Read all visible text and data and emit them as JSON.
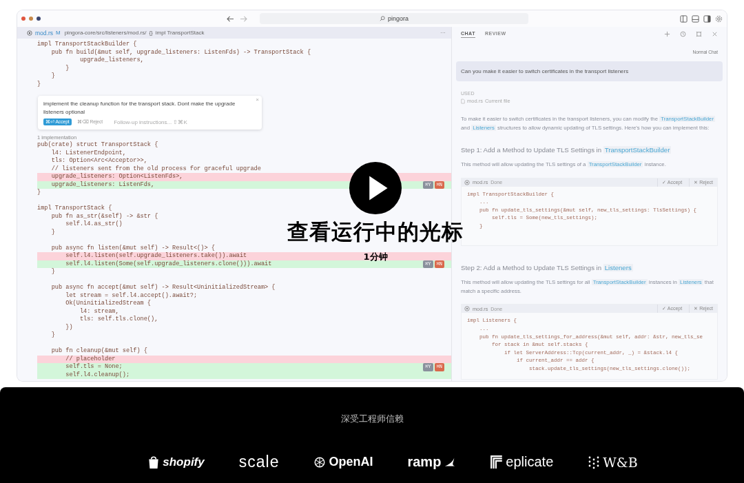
{
  "window": {
    "search": "pingora"
  },
  "editor_tab": {
    "file": "mod.rs",
    "status": "M",
    "path": "pingora-core/src/listeners/mod.rs/",
    "symbol_icon": "{}",
    "symbol": "impl TransportStack",
    "more": "···"
  },
  "editor": [
    {
      "kind": "code",
      "lines": [
        {
          "text": "impl TransportStackBuilder {",
          "added": false,
          "removed": false
        },
        {
          "text": "    pub fn build(&mut self, upgrade_listeners: ListenFds) -> TransportStack {",
          "added": false,
          "removed": false
        },
        {
          "text": "            upgrade_listeners,",
          "added": false,
          "removed": false
        },
        {
          "text": "        }",
          "added": false,
          "removed": false
        },
        {
          "text": "    }",
          "added": false,
          "removed": false
        },
        {
          "text": "}",
          "added": false,
          "removed": false
        }
      ]
    },
    {
      "kind": "prompt",
      "text": "implement the cleanup function for the transport stack. Dont make the upgrade listeners optional",
      "close": "×",
      "accept": "⌘⏎ Accept",
      "reject": "⌘⌫ Reject",
      "followup": "Follow-up instructions... ⇧⌘K"
    },
    {
      "kind": "lens",
      "text": "1 implementation"
    },
    {
      "kind": "code",
      "lines": [
        {
          "text": "pub(crate) struct TransportStack {",
          "added": false,
          "removed": false
        },
        {
          "text": "    l4: ListenerEndpoint,",
          "added": false,
          "removed": false
        },
        {
          "text": "    tls: Option<Arc<Acceptor>>,",
          "added": false,
          "removed": false
        },
        {
          "text": "    // listeners sent from the old process for graceful upgrade",
          "added": false,
          "removed": false
        },
        {
          "text": "    upgrade_listeners: Option<ListenFds>,",
          "added": false,
          "removed": true
        },
        {
          "text": "    upgrade_listeners: ListenFds,",
          "added": true,
          "removed": false,
          "actions": [
            "⌘Y",
            "⌘N"
          ]
        },
        {
          "text": "}",
          "added": false,
          "removed": false
        }
      ]
    },
    {
      "kind": "code",
      "lines": [
        {
          "text": "impl TransportStack {",
          "added": false,
          "removed": false
        },
        {
          "text": "    pub fn as_str(&self) -> &str {",
          "added": false,
          "removed": false
        },
        {
          "text": "        self.l4.as_str()",
          "added": false,
          "removed": false
        },
        {
          "text": "    }",
          "added": false,
          "removed": false
        }
      ]
    },
    {
      "kind": "code",
      "lines": [
        {
          "text": "    pub async fn listen(&mut self) -> Result<()> {",
          "added": false,
          "removed": false
        },
        {
          "text": "        self.l4.listen(self.upgrade_listeners.take()).await",
          "added": false,
          "removed": true
        },
        {
          "text": "        self.l4.listen(Some(self.upgrade_listeners.clone())).await",
          "added": true,
          "removed": false,
          "actions": [
            "⌘Y",
            "⌘N"
          ]
        },
        {
          "text": "    }",
          "added": false,
          "removed": false
        }
      ]
    },
    {
      "kind": "code",
      "lines": [
        {
          "text": "    pub async fn accept(&mut self) -> Result<UninitializedStream> {",
          "added": false,
          "removed": false
        },
        {
          "text": "        let stream = self.l4.accept().await?;",
          "added": false,
          "removed": false
        },
        {
          "text": "        Ok(UninitializedStream {",
          "added": false,
          "removed": false
        },
        {
          "text": "            l4: stream,",
          "added": false,
          "removed": false
        },
        {
          "text": "            tls: self.tls.clone(),",
          "added": false,
          "removed": false
        },
        {
          "text": "        })",
          "added": false,
          "removed": false
        },
        {
          "text": "    }",
          "added": false,
          "removed": false
        }
      ]
    },
    {
      "kind": "code",
      "lines": [
        {
          "text": "    pub fn cleanup(&mut self) {",
          "added": false,
          "removed": false
        },
        {
          "text": "        // placeholder",
          "added": false,
          "removed": true
        },
        {
          "text": "        self.tls = None;",
          "added": true,
          "removed": false,
          "actions": [
            "⌘Y",
            "⌘N"
          ]
        },
        {
          "text": "        self.l4.cleanup();",
          "added": true,
          "removed": false
        }
      ]
    }
  ],
  "chat": {
    "tabs": [
      {
        "label": "CHAT",
        "selected": true
      },
      {
        "label": "REVIEW",
        "selected": false
      }
    ],
    "mode": "Normal Chat",
    "user_message": "Can you make it easier to switch certificates in the transport listeners",
    "used": {
      "label": "USED",
      "file": "mod.rs",
      "note": "Current file"
    },
    "blocks": [
      {
        "kind": "paragraph",
        "parts": [
          {
            "text": "To make it easier to switch certificates in the transport listeners, you can modify the ",
            "code": false
          },
          {
            "text": "TransportStackBuilder",
            "code": true
          },
          {
            "text": " and ",
            "code": false
          },
          {
            "text": "Listeners",
            "code": true
          },
          {
            "text": " structures to allow dynamic updating of TLS settings. Here's how you can implement this:",
            "code": false
          }
        ]
      },
      {
        "kind": "heading",
        "parts": [
          {
            "text": "Step 1: Add a Method to Update TLS Settings in ",
            "code": false
          },
          {
            "text": "TransportStackBuilder",
            "code": true
          }
        ]
      },
      {
        "kind": "paragraph",
        "parts": [
          {
            "text": "This method will allow updating the TLS settings of a ",
            "code": false
          },
          {
            "text": "TransportStackBuilder",
            "code": true
          },
          {
            "text": " instance.",
            "code": false
          }
        ]
      },
      {
        "kind": "code",
        "file": "mod.rs",
        "status": "Done",
        "accept": "✓ Accept",
        "reject": "✕ Reject",
        "lines": [
          "impl TransportStackBuilder {",
          "    ...",
          "    pub fn update_tls_settings(&mut self, new_tls_settings: TlsSettings) {",
          "        self.tls = Some(new_tls_settings);",
          "    }"
        ]
      },
      {
        "kind": "heading",
        "parts": [
          {
            "text": "Step 2: Add a Method to Update TLS Settings in ",
            "code": false
          },
          {
            "text": "Listeners",
            "code": true
          }
        ]
      },
      {
        "kind": "paragraph",
        "parts": [
          {
            "text": "This method will allow updating the TLS settings for all ",
            "code": false
          },
          {
            "text": "TransportStackBuilder",
            "code": true
          },
          {
            "text": " instances in ",
            "code": false
          },
          {
            "text": "Listeners",
            "code": true
          },
          {
            "text": " that match a specific address.",
            "code": false
          }
        ]
      },
      {
        "kind": "code",
        "file": "mod.rs",
        "status": "Done",
        "accept": "✓ Accept",
        "reject": "✕ Reject",
        "lines": [
          "impl Listeners {",
          "    ...",
          "    pub fn update_tls_settings_for_address(&mut self, addr: &str, new_tls_se",
          "        for stack in &mut self.stacks {",
          "            if let ServerAddress::Tcp(current_addr, _) = &stack.l4 {",
          "                if current_addr == addr {",
          "                    stack.update_tls_settings(new_tls_settings.clone());"
        ]
      }
    ]
  },
  "video": {
    "title": "查看运行中的光标",
    "duration": "1分钟"
  },
  "trusted": {
    "heading": "深受工程师信赖",
    "logos": [
      {
        "kind": "shopify",
        "text": "shopify"
      },
      {
        "kind": "scale",
        "text": "scale"
      },
      {
        "kind": "openai",
        "text": "OpenAI"
      },
      {
        "kind": "ramp",
        "text": "ramp"
      },
      {
        "kind": "replicate",
        "text": "eplicate"
      },
      {
        "kind": "wandb",
        "text": "W&B"
      }
    ]
  }
}
